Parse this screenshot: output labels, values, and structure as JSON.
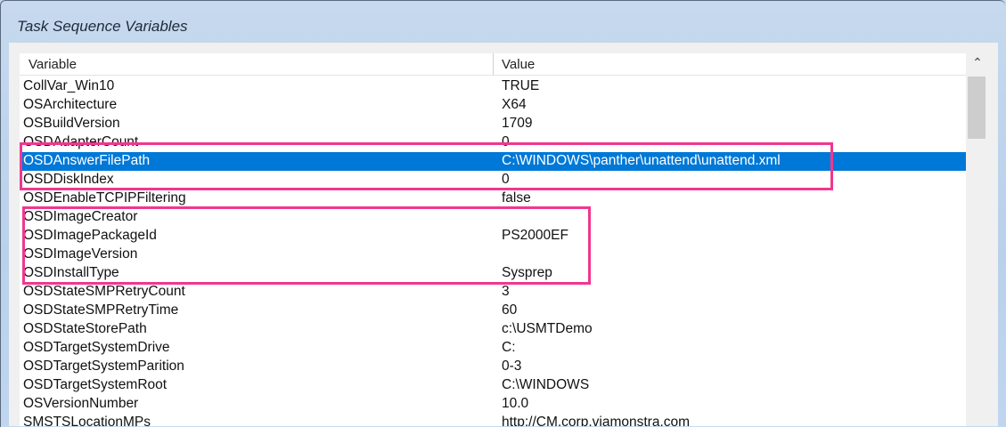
{
  "window": {
    "title": "Task Sequence Variables"
  },
  "columns": {
    "variable": "Variable",
    "value": "Value"
  },
  "rows": [
    {
      "variable": "CollVar_Win10",
      "value": "TRUE"
    },
    {
      "variable": "OSArchitecture",
      "value": "X64"
    },
    {
      "variable": "OSBuildVersion",
      "value": "1709"
    },
    {
      "variable": "OSDAdapterCount",
      "value": "0"
    },
    {
      "variable": "OSDAnswerFilePath",
      "value": "C:\\WINDOWS\\panther\\unattend\\unattend.xml",
      "selected": true
    },
    {
      "variable": "OSDDiskIndex",
      "value": "0"
    },
    {
      "variable": "OSDEnableTCPIPFiltering",
      "value": "false"
    },
    {
      "variable": "OSDImageCreator",
      "value": ""
    },
    {
      "variable": "OSDImagePackageId",
      "value": "PS2000EF"
    },
    {
      "variable": "OSDImageVersion",
      "value": ""
    },
    {
      "variable": "OSDInstallType",
      "value": "Sysprep"
    },
    {
      "variable": "OSDStateSMPRetryCount",
      "value": "3"
    },
    {
      "variable": "OSDStateSMPRetryTime",
      "value": "60"
    },
    {
      "variable": "OSDStateStorePath",
      "value": "c:\\USMTDemo"
    },
    {
      "variable": "OSDTargetSystemDrive",
      "value": "C:"
    },
    {
      "variable": "OSDTargetSystemParition",
      "value": "0-3"
    },
    {
      "variable": "OSDTargetSystemRoot",
      "value": "C:\\WINDOWS"
    },
    {
      "variable": "OSVersionNumber",
      "value": "10.0"
    },
    {
      "variable": "SMSTSLocationMPs",
      "value": "http://CM.corp.viamonstra.com"
    }
  ],
  "colors": {
    "selection": "#0078d7",
    "highlight_box": "#f0378f"
  }
}
